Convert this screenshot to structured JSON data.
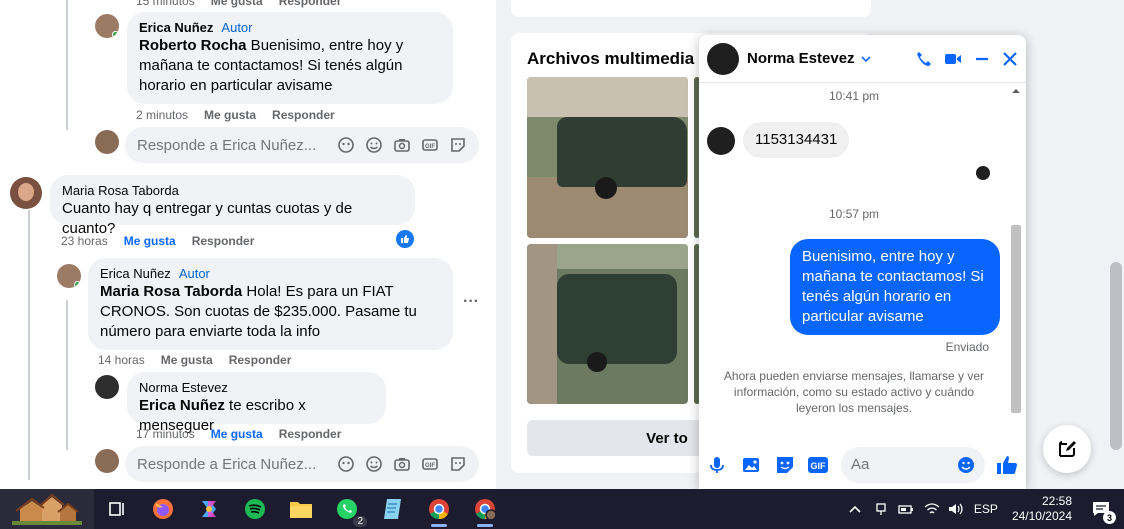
{
  "feed": {
    "top_row": {
      "time": "15 minutos",
      "like": "Me gusta",
      "reply": "Responder"
    },
    "comment1": {
      "author": "Erica Nuñez",
      "badge": "Autor",
      "mention": "Roberto Rocha",
      "text": " Buenisimo, entre hoy y mañana te contactamos! Si tenés algún horario en particular avisame",
      "time": "2 minutos",
      "like": "Me gusta",
      "reply": "Responder"
    },
    "reply_box1": {
      "placeholder": "Responde a Erica Nuñez..."
    },
    "comment2": {
      "author": "Maria Rosa Taborda",
      "text": "Cuanto hay q entregar y cuntas cuotas y de cuanto?",
      "time": "23 horas",
      "like": "Me gusta",
      "reply": "Responder"
    },
    "comment3": {
      "author": "Erica Nuñez",
      "badge": "Autor",
      "mention": "Maria Rosa Taborda",
      "text": " Hola! Es para un FIAT CRONOS. Son cuotas de $235.000. Pasame tu número para enviarte toda la info",
      "time": "14 horas",
      "like": "Me gusta",
      "reply": "Responder"
    },
    "comment4": {
      "author": "Norma Estevez",
      "mention": "Erica Nuñez",
      "text": " te escribo x menseguer",
      "time": "17 minutos",
      "like": "Me gusta",
      "reply": "Responder"
    },
    "reply_box2": {
      "placeholder": "Responde a Erica Nuñez..."
    }
  },
  "media": {
    "title": "Archivos multimedia re",
    "view_all": "Ver to"
  },
  "chat": {
    "name": "Norma Estevez",
    "time1": "10:41 pm",
    "incoming": "1153134431",
    "time2": "10:57 pm",
    "outgoing": "Buenisimo, entre hoy y mañana te contactamos! Si tenés algún horario en particular avisame",
    "status": "Enviado",
    "info": "Ahora pueden enviarse mensajes, llamarse y ver información, como su estado activo y cuándo leyeron los mensajes.",
    "input_placeholder": "Aa",
    "accent": "#0866ff"
  },
  "taskbar": {
    "whatsapp_badge": "2",
    "lang": "ESP",
    "time": "22:58",
    "date": "24/10/2024",
    "notif_count": "3"
  }
}
